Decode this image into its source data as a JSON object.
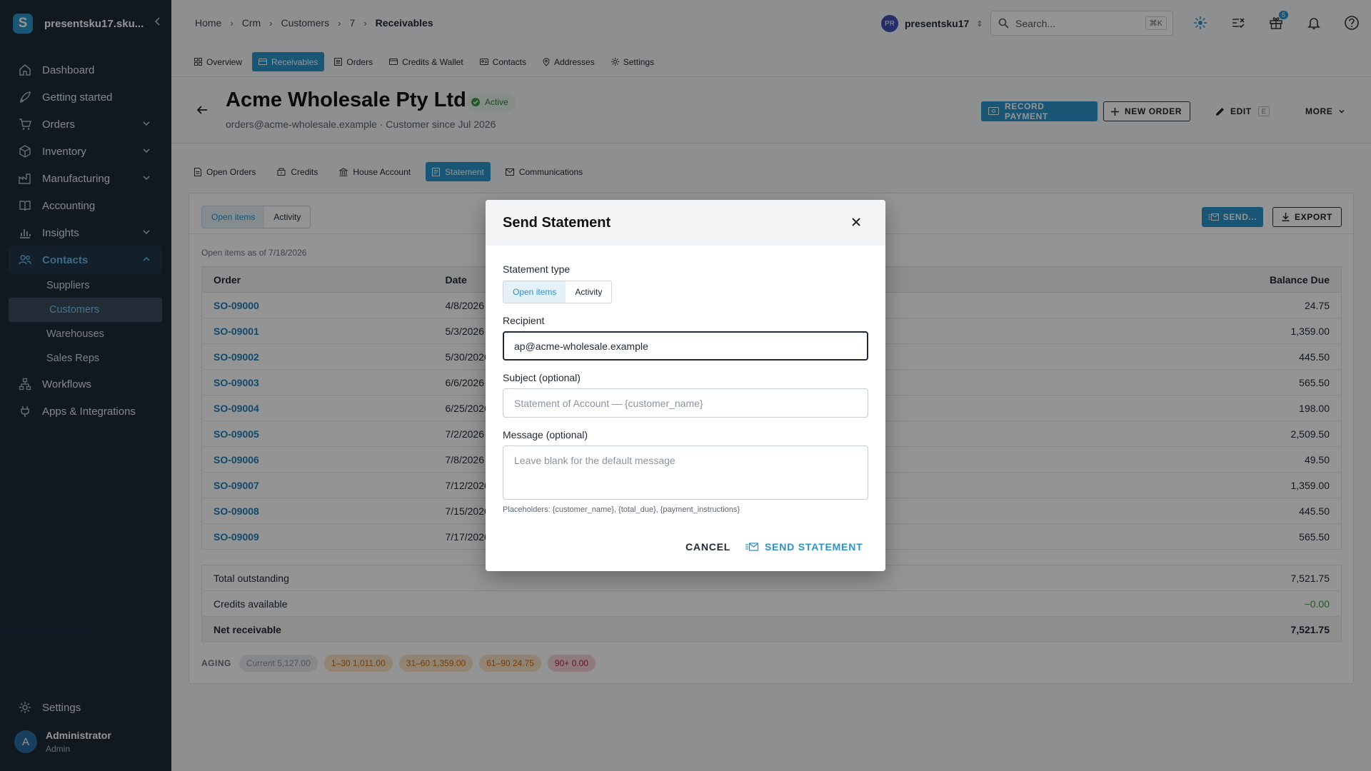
{
  "sidebar": {
    "brand": "presentsku17.sku...",
    "items": [
      {
        "label": "Dashboard"
      },
      {
        "label": "Getting started"
      },
      {
        "label": "Orders"
      },
      {
        "label": "Inventory"
      },
      {
        "label": "Manufacturing"
      },
      {
        "label": "Accounting"
      },
      {
        "label": "Insights"
      },
      {
        "label": "Contacts"
      },
      {
        "label": "Workflows"
      },
      {
        "label": "Apps & Integrations"
      }
    ],
    "contacts_sub": [
      "Suppliers",
      "Customers",
      "Warehouses",
      "Sales Reps"
    ],
    "settings": "Settings",
    "user": {
      "initial": "A",
      "name": "Administrator",
      "role": "Admin"
    }
  },
  "topbar": {
    "breadcrumb": [
      "Home",
      "Crm",
      "Customers",
      "7",
      "Receivables"
    ],
    "workspace_initials": "PR",
    "workspace": "presentsku17",
    "search_placeholder": "Search...",
    "search_kbd": "⌘K",
    "gift_badge": "5"
  },
  "page_tabs": [
    "Overview",
    "Receivables",
    "Orders",
    "Credits & Wallet",
    "Contacts",
    "Addresses",
    "Settings"
  ],
  "header": {
    "title": "Acme Wholesale Pty Ltd",
    "status": "Active",
    "subtitle": "orders@acme-wholesale.example · Customer since Jul 2026",
    "record_payment": "RECORD PAYMENT",
    "new_order": "NEW ORDER",
    "edit": "EDIT",
    "edit_kbd": "E",
    "more": "MORE"
  },
  "section_tabs": [
    "Open Orders",
    "Credits",
    "House Account",
    "Statement",
    "Communications"
  ],
  "statement": {
    "toggle": [
      "Open items",
      "Activity"
    ],
    "send": "SEND...",
    "export": "EXPORT",
    "as_of": "Open items as of 7/18/2026",
    "columns": {
      "order": "Order",
      "date": "Date",
      "balance": "Balance Due"
    },
    "rows": [
      {
        "order": "SO-09000",
        "date": "4/8/2026",
        "balance": "24.75"
      },
      {
        "order": "SO-09001",
        "date": "5/3/2026",
        "balance": "1,359.00"
      },
      {
        "order": "SO-09002",
        "date": "5/30/2026",
        "balance": "445.50"
      },
      {
        "order": "SO-09003",
        "date": "6/6/2026",
        "balance": "565.50"
      },
      {
        "order": "SO-09004",
        "date": "6/25/2026",
        "balance": "198.00"
      },
      {
        "order": "SO-09005",
        "date": "7/2/2026",
        "balance": "2,509.50"
      },
      {
        "order": "SO-09006",
        "date": "7/8/2026",
        "balance": "49.50"
      },
      {
        "order": "SO-09007",
        "date": "7/12/2026",
        "balance": "1,359.00"
      },
      {
        "order": "SO-09008",
        "date": "7/15/2026",
        "balance": "445.50"
      },
      {
        "order": "SO-09009",
        "date": "7/17/2026",
        "balance": "565.50"
      }
    ],
    "totals": [
      {
        "label": "Total outstanding",
        "value": "7,521.75"
      },
      {
        "label": "Credits available",
        "value": "−0.00"
      },
      {
        "label": "Net receivable",
        "value": "7,521.75"
      }
    ],
    "aging_label": "AGING",
    "aging": [
      {
        "label": "Current 5,127.00",
        "bg": "#e9ebee",
        "fg": "#8a939c"
      },
      {
        "label": "1–30 1,011.00",
        "bg": "#fbe3c6",
        "fg": "#c46a12"
      },
      {
        "label": "31–60 1,359.00",
        "bg": "#fbe3c6",
        "fg": "#c46a12"
      },
      {
        "label": "61–90 24.75",
        "bg": "#fbe3c6",
        "fg": "#c46a12"
      },
      {
        "label": "90+ 0.00",
        "bg": "#f6d3d7",
        "fg": "#b0293a"
      }
    ]
  },
  "modal": {
    "title": "Send Statement",
    "type_label": "Statement type",
    "type_options": [
      "Open items",
      "Activity"
    ],
    "recipient_label": "Recipient",
    "recipient_value": "ap@acme-wholesale.example",
    "subject_label": "Subject (optional)",
    "subject_placeholder": "Statement of Account — {customer_name}",
    "message_label": "Message (optional)",
    "message_placeholder": "Leave blank for the default message",
    "hint": "Placeholders: {customer_name}, {total_due}, {payment_instructions}",
    "cancel": "CANCEL",
    "send": "SEND STATEMENT"
  },
  "colors": {
    "accent": "#2c93c8",
    "sidebar": "#1c2b38",
    "link": "#1e7fb8",
    "success": "#3e9a46"
  }
}
